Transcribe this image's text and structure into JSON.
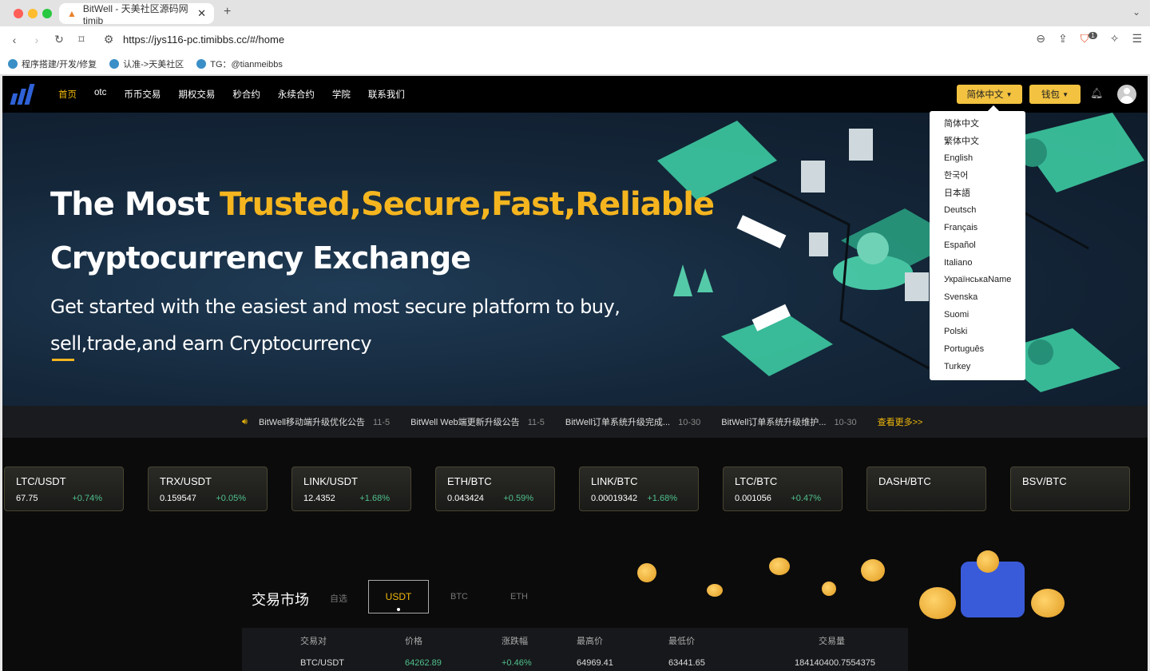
{
  "browser": {
    "tab_title": "BitWell - 天美社区源码网timib",
    "url": "https://jys116-pc.timibbs.cc/#/home",
    "bookmarks": [
      "程序搭建/开发/修复",
      "认准->天美社区",
      "TG：@tianmeibbs"
    ],
    "badge_count": "1"
  },
  "nav": {
    "items": [
      "首页",
      "otc",
      "币币交易",
      "期权交易",
      "秒合约",
      "永续合约",
      "学院",
      "联系我们"
    ],
    "lang_button": "简体中文",
    "wallet_button": "钱包"
  },
  "languages": [
    "简体中文",
    "繁体中文",
    "English",
    "한국어",
    "日本語",
    "Deutsch",
    "Français",
    "Español",
    "Italiano",
    "УкраїнськаName",
    "Svenska",
    "Suomi",
    "Polski",
    "Português",
    "Turkey"
  ],
  "hero": {
    "title_white": "The Most ",
    "title_yellow": "Trusted,Secure,Fast,Reliable",
    "title2": "Cryptocurrency Exchange",
    "subtitle": "Get started with the easiest and most secure platform to buy, sell,trade,and earn Cryptocurrency"
  },
  "notices": {
    "items": [
      {
        "text": "BitWell移动端升级优化公告",
        "date": "11-5"
      },
      {
        "text": "BitWell Web端更新升级公告",
        "date": "11-5"
      },
      {
        "text": "BitWell订单系统升级完成...",
        "date": "10-30"
      },
      {
        "text": "BitWell订单系统升级维护...",
        "date": "10-30"
      }
    ],
    "more": "查看更多>>"
  },
  "tickers": [
    {
      "pair": "LTC/USDT",
      "price": "67.75",
      "change": "+0.74%"
    },
    {
      "pair": "TRX/USDT",
      "price": "0.159547",
      "change": "+0.05%"
    },
    {
      "pair": "LINK/USDT",
      "price": "12.4352",
      "change": "+1.68%"
    },
    {
      "pair": "ETH/BTC",
      "price": "0.043424",
      "change": "+0.59%"
    },
    {
      "pair": "LINK/BTC",
      "price": "0.00019342",
      "change": "+1.68%"
    },
    {
      "pair": "LTC/BTC",
      "price": "0.001056",
      "change": "+0.47%"
    },
    {
      "pair": "DASH/BTC",
      "price": "",
      "change": ""
    },
    {
      "pair": "BSV/BTC",
      "price": "",
      "change": ""
    }
  ],
  "market": {
    "title": "交易市场",
    "tabs": [
      "自选",
      "USDT",
      "BTC",
      "ETH"
    ],
    "columns": [
      "交易对",
      "价格",
      "涨跌幅",
      "最高价",
      "最低价",
      "交易量"
    ],
    "rows": [
      [
        "BTC/USDT",
        "64262.89",
        "+0.46%",
        "64969.41",
        "63441.65",
        "184140400.7554375"
      ]
    ]
  }
}
